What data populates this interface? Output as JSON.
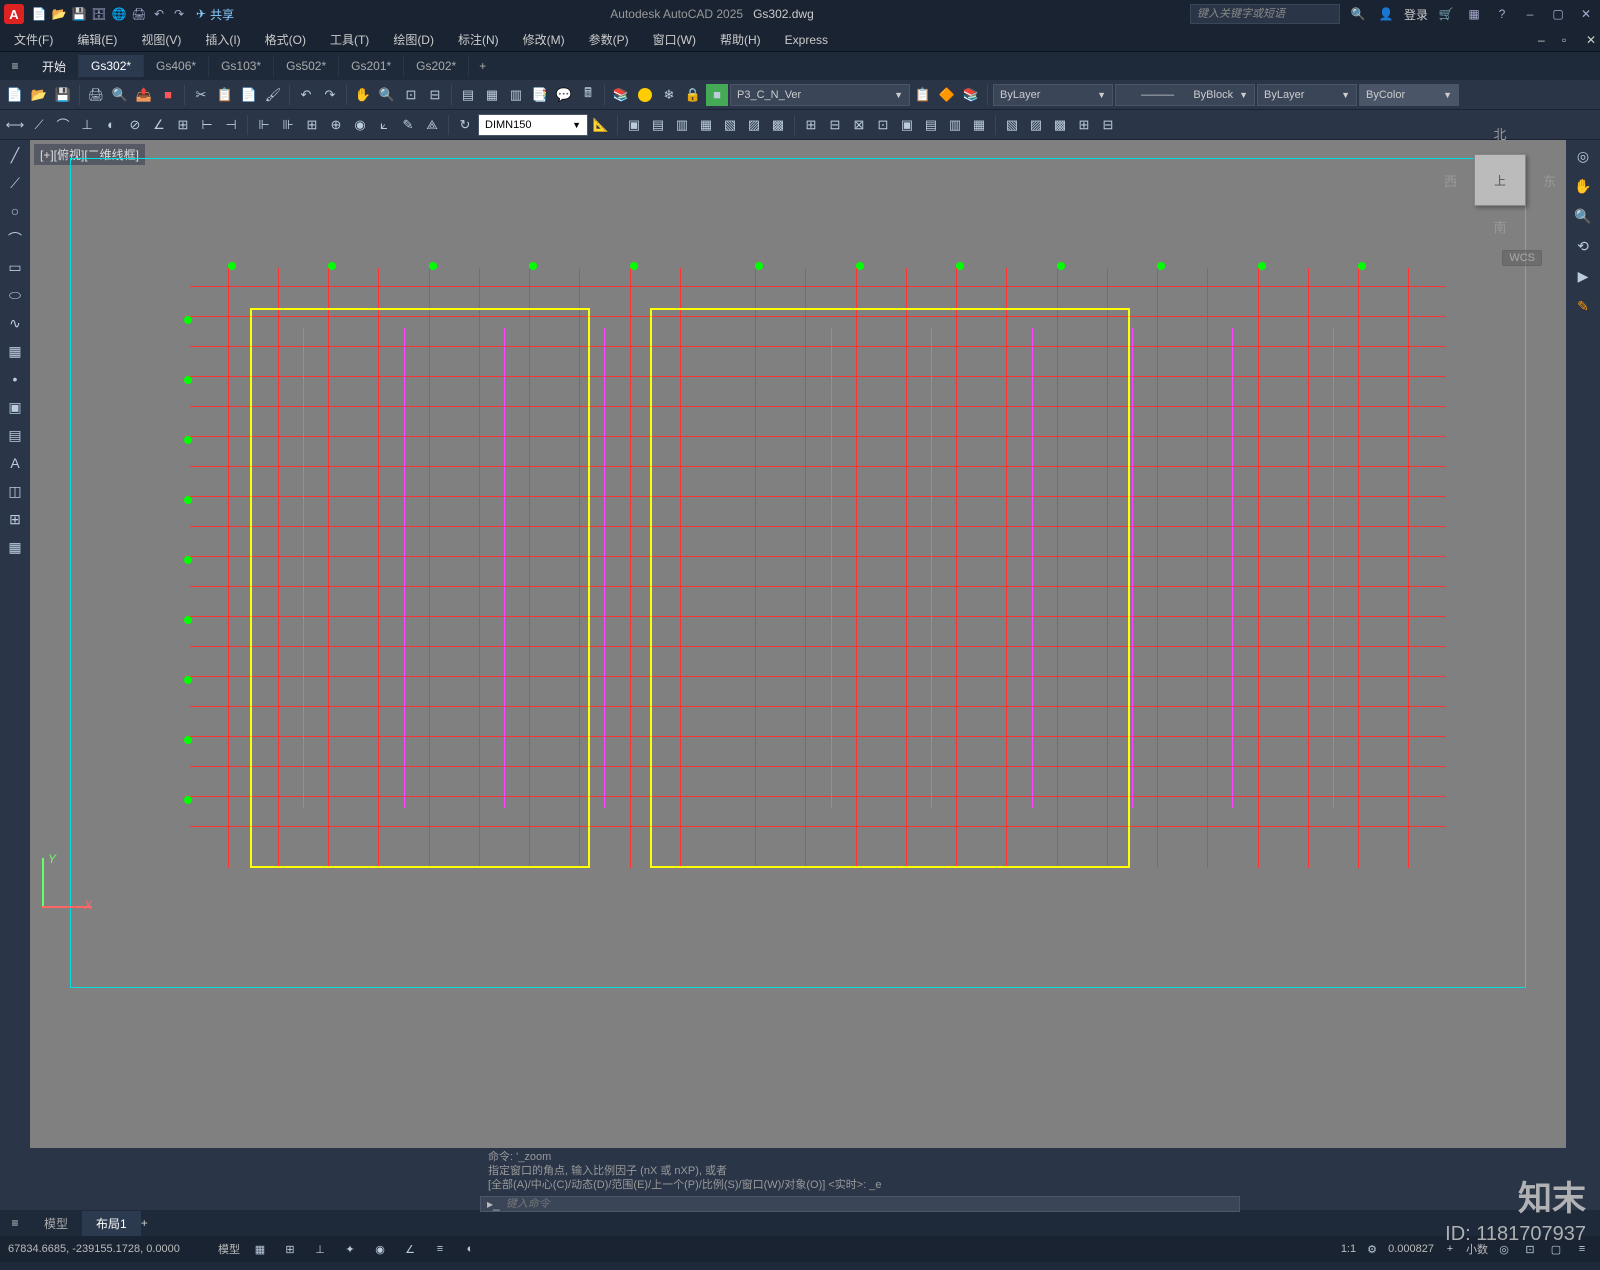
{
  "titlebar": {
    "app": "Autodesk AutoCAD 2025",
    "file": "Gs302.dwg",
    "share": "共享",
    "search_placeholder": "键入关键字或短语",
    "login": "登录"
  },
  "menu": {
    "file": "文件(F)",
    "edit": "编辑(E)",
    "view": "视图(V)",
    "insert": "插入(I)",
    "format": "格式(O)",
    "tools": "工具(T)",
    "draw": "绘图(D)",
    "dim": "标注(N)",
    "modify": "修改(M)",
    "param": "参数(P)",
    "window": "窗口(W)",
    "help": "帮助(H)",
    "express": "Express"
  },
  "filetabs": {
    "start": "开始",
    "t0": "Gs302*",
    "t1": "Gs406*",
    "t2": "Gs103*",
    "t3": "Gs502*",
    "t4": "Gs201*",
    "t5": "Gs202*"
  },
  "toolbar1": {
    "layerfilter": "P3_C_N_Ver",
    "layer": "ByLayer",
    "lineweight": "ByBlock",
    "linetype": "ByLayer",
    "color": "ByColor"
  },
  "toolbar2": {
    "dimstyle": "DIMN150"
  },
  "canvas": {
    "viewlabel": "[+][俯视][二维线框]"
  },
  "viewcube": {
    "top": "上",
    "n": "北",
    "s": "南",
    "e": "东",
    "w": "西",
    "wcs": "WCS"
  },
  "cmd": {
    "l1": "命令: '_zoom",
    "l2": "指定窗口的角点, 输入比例因子 (nX 或 nXP), 或者",
    "l3": "[全部(A)/中心(C)/动态(D)/范围(E)/上一个(P)/比例(S)/窗口(W)/对象(O)] <实时>: _e",
    "prompt": "▸_",
    "placeholder": "键入命令"
  },
  "layouts": {
    "model": "模型",
    "layout1": "布局1"
  },
  "status": {
    "coords": "67834.6685, -239155.1728, 0.0000",
    "space": "模型",
    "scale": "1:1",
    "angle": "0.000827",
    "decimal": "小数"
  },
  "axis": {
    "x": "X",
    "y": "Y"
  },
  "watermark": {
    "brand": "知末",
    "id": "ID: 1181707937"
  }
}
